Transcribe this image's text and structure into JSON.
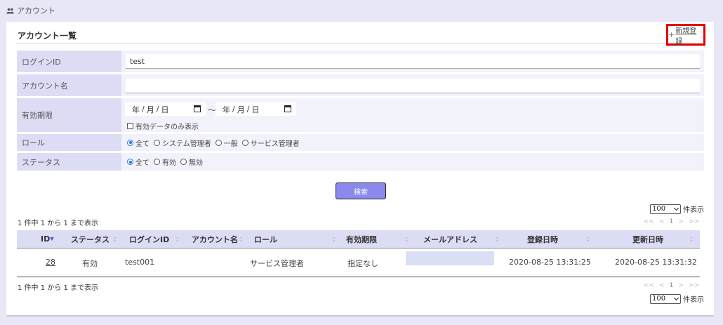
{
  "breadcrumb": {
    "icon": "users-icon",
    "label": "アカウント"
  },
  "panel": {
    "title": "アカウント一覧",
    "new_label": "新規登録",
    "new_icon": "+"
  },
  "filters": {
    "login_id": {
      "label": "ログインID",
      "value": "test"
    },
    "account_name": {
      "label": "アカウント名",
      "value": ""
    },
    "validity": {
      "label": "有効期限",
      "date_from": {
        "y": "年",
        "m": "月",
        "d": "日"
      },
      "date_to": {
        "y": "年",
        "m": "月",
        "d": "日"
      },
      "range_sep": "～",
      "only_valid_label": "有効データのみ表示",
      "only_valid_checked": false
    },
    "role": {
      "label": "ロール",
      "options": [
        "全て",
        "システム管理者",
        "一般",
        "サービス管理者"
      ],
      "selected": "全て"
    },
    "status": {
      "label": "ステータス",
      "options": [
        "全て",
        "有効",
        "無効"
      ],
      "selected": "全て"
    }
  },
  "search_button": "検索",
  "page_size": {
    "value": "100",
    "suffix": "件表示"
  },
  "count_text": "1 件中 1 から 1 まで表示",
  "pager": {
    "first": "<<",
    "prev": "<",
    "current": "1",
    "next": ">",
    "last": ">>"
  },
  "table": {
    "headers": [
      "ID",
      "ステータス",
      "ログインID",
      "アカウント名",
      "ロール",
      "有効期限",
      "メールアドレス",
      "登録日時",
      "更新日時"
    ],
    "rows": [
      {
        "id": "28",
        "status": "有効",
        "login_id": "test001",
        "account_name": "",
        "role": "サービス管理者",
        "validity": "指定なし",
        "email": "",
        "created": "2020-08-25 13:31:25",
        "updated": "2020-08-25 13:31:32"
      }
    ]
  },
  "colors": {
    "accent": "#8a8aee",
    "header_bg": "#dcdcf5",
    "highlight_border": "#e30000",
    "page_bg": "#e7e7f7"
  }
}
